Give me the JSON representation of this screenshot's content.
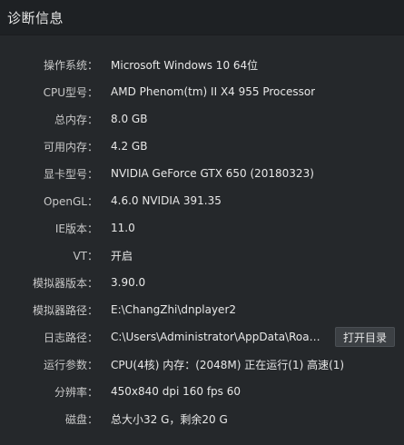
{
  "window": {
    "title": "诊断信息"
  },
  "rows": [
    {
      "label": "操作系统：",
      "value": "Microsoft Windows 10 64位"
    },
    {
      "label": "CPU型号：",
      "value": "AMD Phenom(tm) II X4 955 Processor"
    },
    {
      "label": "总内存：",
      "value": "8.0 GB"
    },
    {
      "label": "可用内存：",
      "value": "4.2 GB"
    },
    {
      "label": "显卡型号：",
      "value": "NVIDIA GeForce GTX 650 (20180323)"
    },
    {
      "label": "OpenGL：",
      "value": "4.6.0 NVIDIA 391.35"
    },
    {
      "label": "IE版本：",
      "value": "11.0"
    },
    {
      "label": "VT：",
      "value": "开启"
    },
    {
      "label": "模拟器版本：",
      "value": "3.90.0"
    },
    {
      "label": "模拟器路径：",
      "value": "E:\\ChangZhi\\dnplayer2"
    },
    {
      "label": "日志路径：",
      "value": "C:\\Users\\Administrator\\AppData\\Roami..."
    },
    {
      "label": "运行参数：",
      "value": "CPU(4核) 内存：(2048M) 正在运行(1) 高速(1)"
    },
    {
      "label": "分辨率：",
      "value": "450x840 dpi 160 fps 60"
    },
    {
      "label": "磁盘：",
      "value": "总大小32 G，剩余20 G"
    }
  ],
  "buttons": {
    "open_dir": "打开目录"
  }
}
